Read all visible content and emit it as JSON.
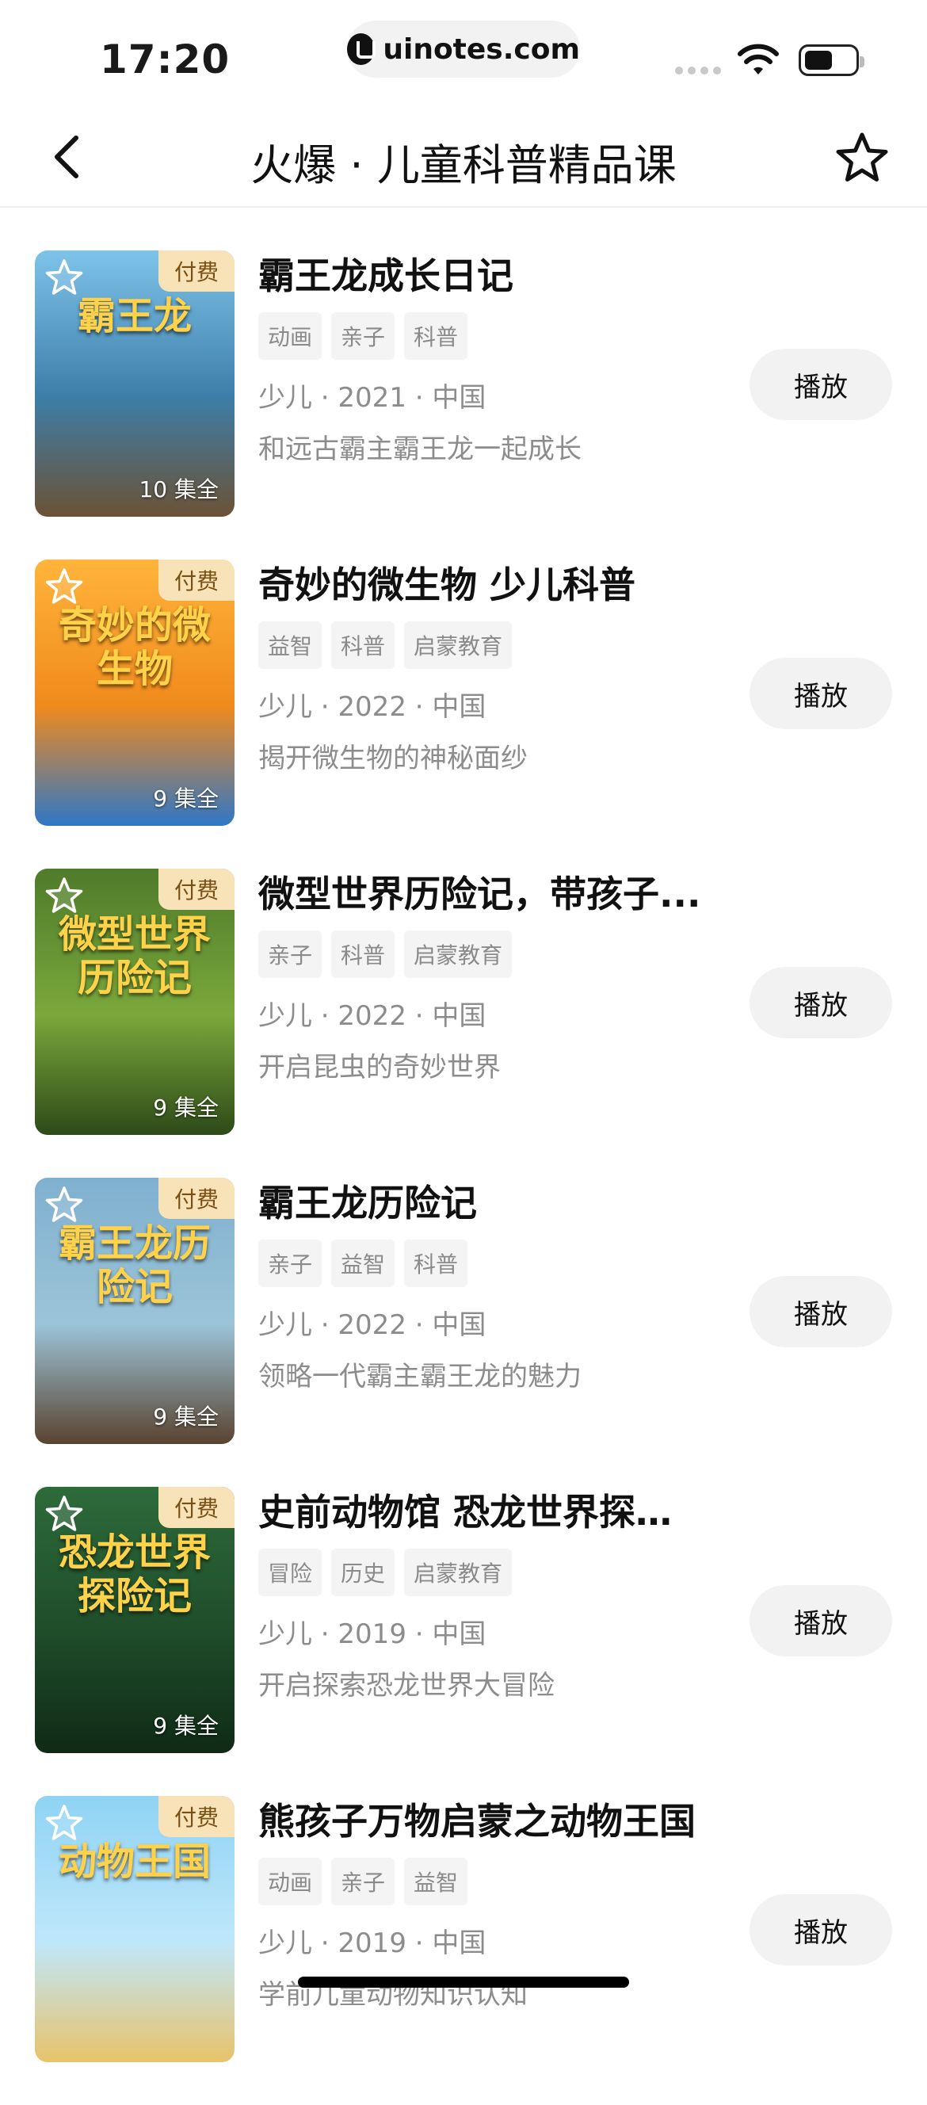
{
  "status_bar": {
    "time": "17:20",
    "url": "uinotes.com"
  },
  "navbar": {
    "title": "火爆 · 儿童科普精品课",
    "back_icon": "chevron-left-icon",
    "favorite_icon": "star-outline-icon"
  },
  "items": [
    {
      "title": "霸王龙成长日记",
      "tags": [
        "动画",
        "亲子",
        "科普"
      ],
      "meta": "少儿 · 2021 · 中国",
      "desc": "和远古霸主霸王龙一起成长",
      "badge": "付费",
      "episodes": "10 集全",
      "play": "播放",
      "poster_text": "霸王龙",
      "poster_colors": [
        "#7ec3ea",
        "#3d7ea8",
        "#6b5236"
      ]
    },
    {
      "title": "奇妙的微生物 少儿科普",
      "tags": [
        "益智",
        "科普",
        "启蒙教育"
      ],
      "meta": "少儿 · 2022 · 中国",
      "desc": "揭开微生物的神秘面纱",
      "badge": "付费",
      "episodes": "9 集全",
      "play": "播放",
      "poster_text": "奇妙的微生物",
      "poster_colors": [
        "#ffb43a",
        "#f08a1c",
        "#2f77c7"
      ]
    },
    {
      "title": "微型世界历险记，带孩子...",
      "tags": [
        "亲子",
        "科普",
        "启蒙教育"
      ],
      "meta": "少儿 · 2022 · 中国",
      "desc": "开启昆虫的奇妙世界",
      "badge": "付费",
      "episodes": "9 集全",
      "play": "播放",
      "poster_text": "微型世界历险记",
      "poster_colors": [
        "#4f7b2b",
        "#7aa83b",
        "#2d4a18"
      ]
    },
    {
      "title": "霸王龙历险记",
      "tags": [
        "亲子",
        "益智",
        "科普"
      ],
      "meta": "少儿 · 2022 · 中国",
      "desc": "领略一代霸主霸王龙的魅力",
      "badge": "付费",
      "episodes": "9 集全",
      "play": "播放",
      "poster_text": "霸王龙历险记",
      "poster_colors": [
        "#7fb0cf",
        "#9bc4d8",
        "#5a4330"
      ]
    },
    {
      "title": "史前动物馆 恐龙世界探险记",
      "tags": [
        "冒险",
        "历史",
        "启蒙教育"
      ],
      "meta": "少儿 · 2019 · 中国",
      "desc": "开启探索恐龙世界大冒险",
      "badge": "付费",
      "episodes": "9 集全",
      "play": "播放",
      "poster_text": "恐龙世界探险记",
      "poster_colors": [
        "#2d6b3a",
        "#1f4c2a",
        "#0f2a16"
      ]
    },
    {
      "title": "熊孩子万物启蒙之动物王国",
      "tags": [
        "动画",
        "亲子",
        "益智"
      ],
      "meta": "少儿 · 2019 · 中国",
      "desc": "学前儿童动物知识认知",
      "badge": "付费",
      "episodes": "",
      "play": "播放",
      "poster_text": "动物王国",
      "poster_colors": [
        "#8fd3f4",
        "#bfe7fb",
        "#e8c36a"
      ]
    }
  ]
}
